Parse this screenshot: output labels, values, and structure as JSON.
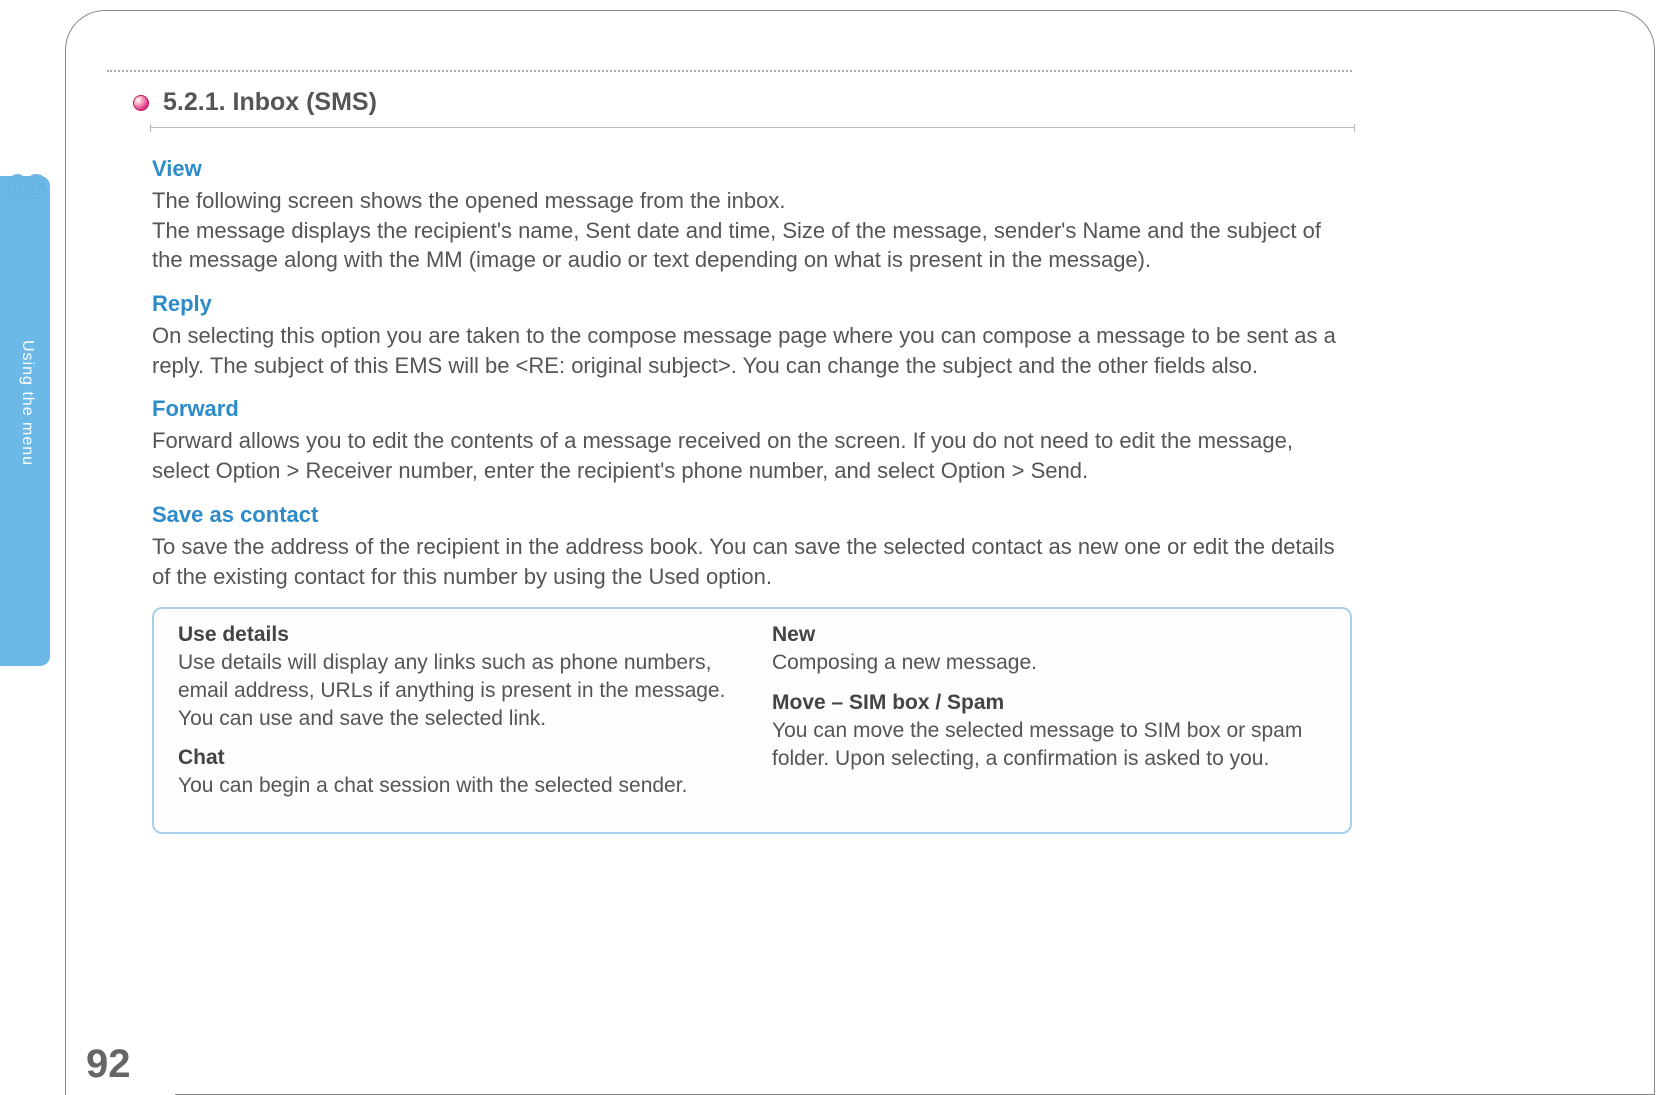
{
  "chapter": {
    "number": "03",
    "label": "Using the menu"
  },
  "page_number": "92",
  "section": {
    "number_title": "5.2.1. Inbox (SMS)"
  },
  "items": [
    {
      "title": "View",
      "body": "The following screen shows the opened message from the inbox.\nThe message displays the recipient's name, Sent date and time, Size of the message, sender's Name and the subject of the message along with the MM (image or audio or text depending on what is present in the message)."
    },
    {
      "title": "Reply",
      "body": "On selecting this option you are taken to the compose message page where you can compose a message to be sent as a reply. The subject of this EMS will be <RE: original subject>. You can change the subject and the other fields also."
    },
    {
      "title": "Forward",
      "body": "Forward allows you to edit the contents of a message received on the screen. If you do not need to edit the message, select Option > Receiver number, enter the recipient's phone number, and select Option > Send."
    },
    {
      "title": "Save as contact",
      "body": "To save the address of the recipient in the address book. You can save the selected contact as new one or edit the details of the existing contact for this number by using the Used option."
    }
  ],
  "box": {
    "left": [
      {
        "title": "Use details",
        "body": "Use details will display any links such as phone numbers, email address, URLs if anything is present in the message.\nYou can use and save the selected link."
      },
      {
        "title": "Chat",
        "body": "You can begin a chat session with the selected sender."
      }
    ],
    "right": [
      {
        "title": "New",
        "body": "Composing a new message."
      },
      {
        "title": "Move – SIM box / Spam",
        "body": "You can move the selected message to SIM box or spam folder. Upon selecting, a confirmation is asked to you."
      }
    ]
  }
}
